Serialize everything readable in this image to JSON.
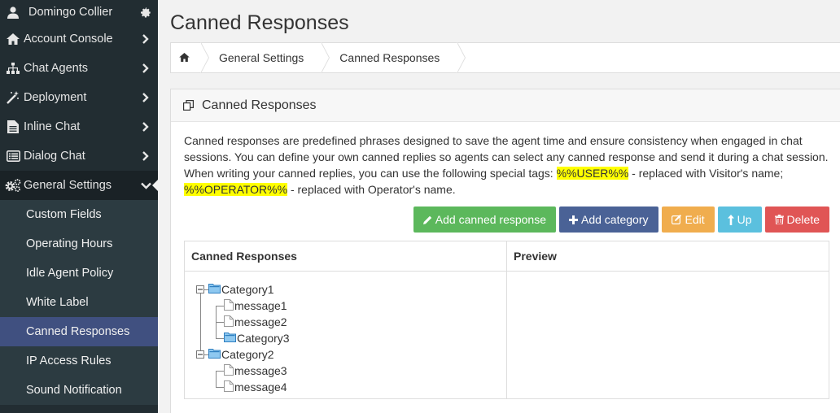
{
  "user": {
    "name": "Domingo Collier"
  },
  "sidebar": {
    "items": [
      {
        "label": "Account Console",
        "icon": "home-icon"
      },
      {
        "label": "Chat Agents",
        "icon": "sitemap-icon"
      },
      {
        "label": "Deployment",
        "icon": "magic-wand-icon"
      },
      {
        "label": "Inline Chat",
        "icon": "file-text-icon"
      },
      {
        "label": "Dialog Chat",
        "icon": "list-alt-icon"
      },
      {
        "label": "General Settings",
        "icon": "cogs-icon"
      }
    ],
    "submenu": [
      {
        "label": "Custom Fields"
      },
      {
        "label": "Operating Hours"
      },
      {
        "label": "Idle Agent Policy"
      },
      {
        "label": "White Label"
      },
      {
        "label": "Canned Responses"
      },
      {
        "label": "IP Access Rules"
      },
      {
        "label": "Sound Notification"
      }
    ]
  },
  "page": {
    "title": "Canned Responses"
  },
  "breadcrumb": {
    "items": [
      "General Settings",
      "Canned Responses"
    ]
  },
  "panel": {
    "title": "Canned Responses",
    "desc_part1": "Canned responses are predefined phrases designed to save the agent time and ensure consistency when engaged in chat sessions. You can define your own canned replies so agents can select any canned response and send it during a chat session. When writing your canned replies, you can use the following special tags: ",
    "tag_user": "%%USER%%",
    "desc_part2": " - replaced with Visitor's name; ",
    "tag_operator": "%%OPERATOR%%",
    "desc_part3": " - replaced with Operator's name."
  },
  "buttons": {
    "add_response": "Add canned response",
    "add_category": "Add category",
    "edit": "Edit",
    "up": "Up",
    "delete": "Delete"
  },
  "grid": {
    "col1": "Canned Responses",
    "col2": "Preview"
  },
  "tree": {
    "nodes": [
      "Category1",
      "message1",
      "message2",
      "Category3",
      "Category2",
      "message3",
      "message4"
    ]
  },
  "colors": {
    "sidebar_bg": "#222d32",
    "submenu_bg": "#2c3b41",
    "selected_bg": "#405080",
    "highlight": "#ffff00"
  }
}
